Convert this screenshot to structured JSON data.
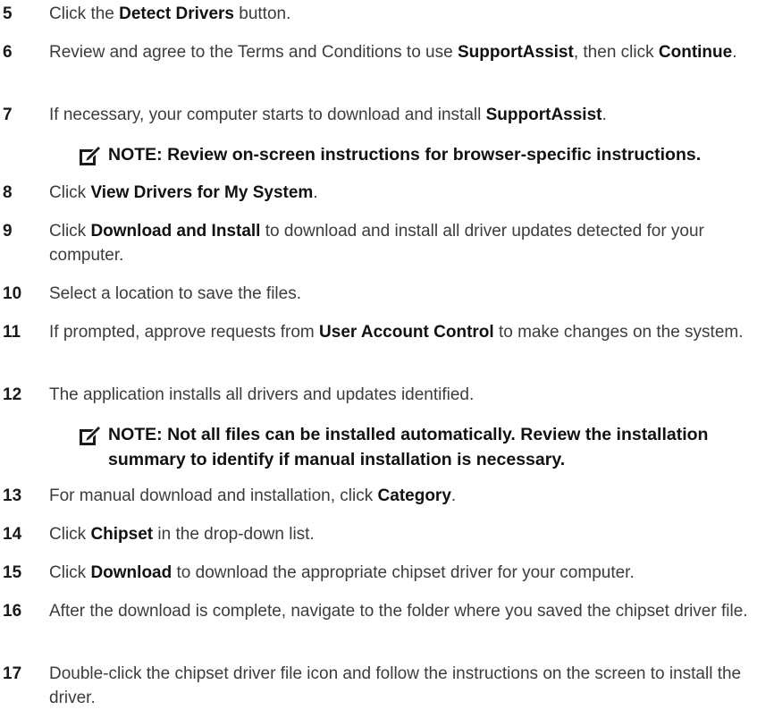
{
  "steps": [
    {
      "num": "5",
      "parts": [
        {
          "t": "Click the "
        },
        {
          "b": "Detect Drivers"
        },
        {
          "t": " button."
        }
      ]
    },
    {
      "num": "6",
      "parts": [
        {
          "t": "Review and agree to the Terms and Conditions to use "
        },
        {
          "b": "SupportAssist"
        },
        {
          "t": ", then click "
        },
        {
          "b": "Continue"
        },
        {
          "t": "."
        }
      ]
    },
    {
      "num": "7",
      "parts": [
        {
          "t": "If necessary, your computer starts to download and install "
        },
        {
          "b": "SupportAssist"
        },
        {
          "t": "."
        }
      ]
    },
    {
      "num": "8",
      "parts": [
        {
          "t": "Click "
        },
        {
          "b": "View Drivers for My System"
        },
        {
          "t": "."
        }
      ]
    },
    {
      "num": "9",
      "parts": [
        {
          "t": "Click "
        },
        {
          "b": "Download and Install"
        },
        {
          "t": " to download and install all driver updates detected for your computer."
        }
      ]
    },
    {
      "num": "10",
      "parts": [
        {
          "t": "Select a location to save the files."
        }
      ]
    },
    {
      "num": "11",
      "parts": [
        {
          "t": "If prompted, approve requests from "
        },
        {
          "b": "User Account Control"
        },
        {
          "t": " to make changes on the system."
        }
      ]
    },
    {
      "num": "12",
      "parts": [
        {
          "t": "The application installs all drivers and updates identified."
        }
      ]
    },
    {
      "num": "13",
      "parts": [
        {
          "t": "For manual download and installation, click "
        },
        {
          "b": "Category"
        },
        {
          "t": "."
        }
      ]
    },
    {
      "num": "14",
      "parts": [
        {
          "t": "Click "
        },
        {
          "b": "Chipset"
        },
        {
          "t": " in the drop-down list."
        }
      ]
    },
    {
      "num": "15",
      "parts": [
        {
          "t": "Click "
        },
        {
          "b": "Download"
        },
        {
          "t": " to download the appropriate chipset driver for your computer."
        }
      ]
    },
    {
      "num": "16",
      "parts": [
        {
          "t": "After the download is complete, navigate to the folder where you saved the chipset driver file."
        }
      ]
    },
    {
      "num": "17",
      "parts": [
        {
          "t": "Double-click the chipset driver file icon and follow the instructions on the screen to install the driver."
        }
      ]
    }
  ],
  "notes": [
    {
      "text": "NOTE: Review on-screen instructions for browser-specific instructions.",
      "icon": "note-pencil-icon"
    },
    {
      "text": "NOTE: Not all files can be installed automatically. Review the installation summary to identify if manual installation is necessary.",
      "icon": "note-pencil-icon"
    }
  ],
  "colors": {
    "text": "#3c3c3c",
    "bold": "#111111",
    "icon": "#1a1a1a"
  }
}
